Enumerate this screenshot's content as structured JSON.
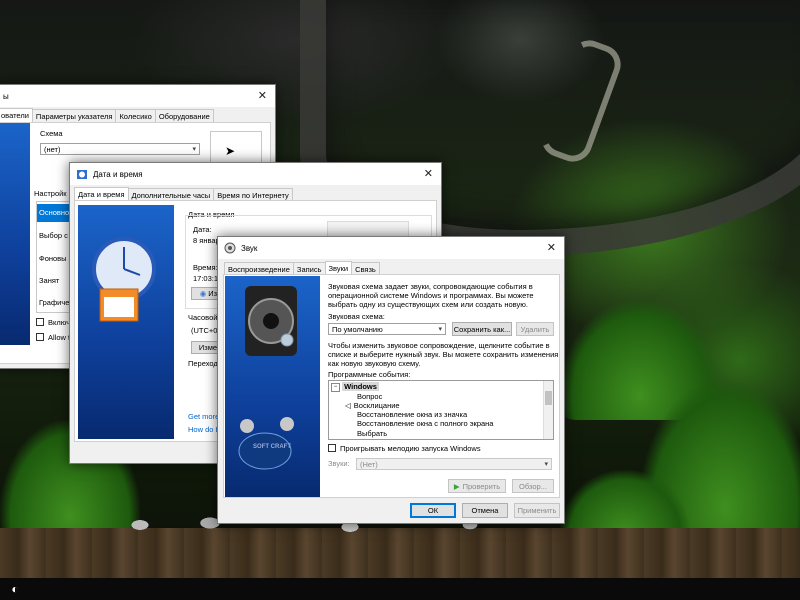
{
  "mouse_window": {
    "title_fragment": "ы",
    "tabs": [
      "ователи",
      "Параметры указателя",
      "Колесико",
      "Оборудование"
    ],
    "scheme_label": "Схема",
    "scheme_value": "(нет)",
    "setup_label": "Настройк",
    "list_items": [
      "Основно",
      "Выбор с",
      "Фоновы",
      "Занят",
      "Графиче"
    ],
    "checkbox1": "Включ",
    "checkbox2": "Allow th"
  },
  "datetime_window": {
    "title": "Дата и время",
    "tabs": [
      "Дата и время",
      "Дополнительные часы",
      "Время по Интернету"
    ],
    "group_label": "Дата и время",
    "date_label": "Дата:",
    "date_value": "8 январ",
    "time_label": "Время:",
    "time_value": "17:03:17",
    "change_btn": "Изм",
    "tz_label": "Часовой",
    "tz_value": "(UTC+03",
    "tz_btn": "Изме",
    "transition": "Переход",
    "link1": "Get more",
    "link2": "How do I"
  },
  "sound_window": {
    "title": "Звук",
    "tabs": [
      "Воспроизведение",
      "Запись",
      "Звуки",
      "Связь"
    ],
    "description": [
      "Звуковая схема задает звуки, сопровождающие события в",
      "операционной системе Windows и программах. Вы можете",
      "выбрать одну из существующих схем или создать новую."
    ],
    "scheme_label": "Звуковая схема:",
    "scheme_value": "По умолчанию",
    "save_as": "Сохранить как...",
    "delete": "Удалить",
    "instructions": [
      "Чтобы изменить звуковое сопровождение, щелкните событие в",
      "списке и выберите нужный звук. Вы можете сохранить изменения",
      "как новую звуковую схему."
    ],
    "events_label": "Программные события:",
    "events": [
      "Windows",
      "Вопрос",
      "Восклицание",
      "Восстановление окна из значка",
      "Восстановление окна с полного экрана",
      "Выбрать"
    ],
    "play_startup": "Проигрывать мелодию запуска Windows",
    "sounds_label": "Звуки:",
    "sounds_value": "(Нет)",
    "test": "Проверить",
    "browse": "Обзор...",
    "ok": "ОК",
    "cancel": "Отмена",
    "apply": "Применить",
    "brand_text": "SOFT CRAFT"
  },
  "colors": {
    "accent": "#0078d7",
    "side_panel": "#1b64c9"
  }
}
